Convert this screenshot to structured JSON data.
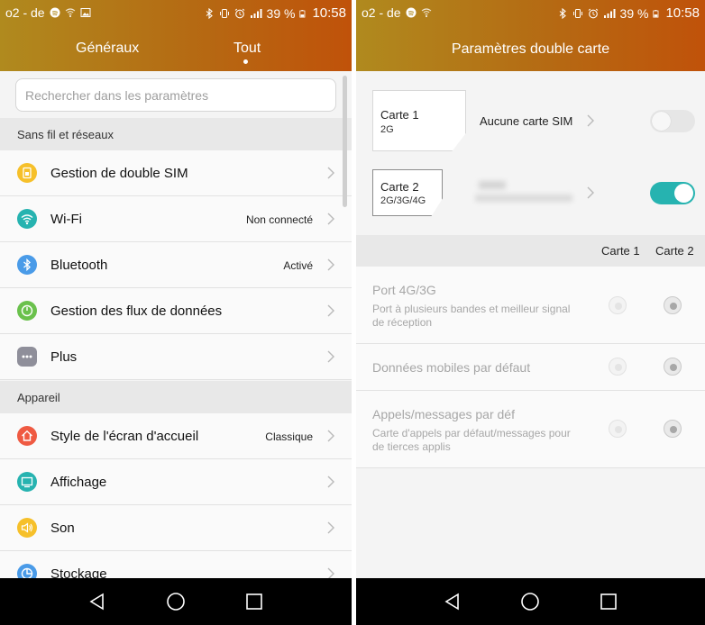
{
  "colors": {
    "header_gradient_start": "#b08a1e",
    "header_gradient_end": "#c0520a",
    "toggle_on": "#26b3b0",
    "toggle_off": "#e6e6e6",
    "section_bg": "#e8e8e8",
    "list_bg": "#fafafa"
  },
  "left": {
    "status": {
      "carrier": "o2 - de",
      "battery": "39 %",
      "time": "10:58"
    },
    "tabs": [
      {
        "label": "Généraux",
        "selected": false
      },
      {
        "label": "Tout",
        "selected": true
      }
    ],
    "search": {
      "placeholder": "Rechercher dans les paramètres"
    },
    "sections": [
      {
        "title": "Sans fil et réseaux",
        "items": [
          {
            "label": "Gestion de double SIM",
            "value": "",
            "icon": "dual-sim-icon",
            "icon_color": "#f6c02a"
          },
          {
            "label": "Wi-Fi",
            "value": "Non connecté",
            "icon": "wifi-icon",
            "icon_color": "#26b3b0"
          },
          {
            "label": "Bluetooth",
            "value": "Activé",
            "icon": "bluetooth-icon",
            "icon_color": "#4a9be8"
          },
          {
            "label": "Gestion des flux de données",
            "value": "",
            "icon": "data-usage-icon",
            "icon_color": "#6ac14c"
          },
          {
            "label": "Plus",
            "value": "",
            "icon": "more-icon",
            "icon_color": "#8f8f9a"
          }
        ]
      },
      {
        "title": "Appareil",
        "items": [
          {
            "label": "Style de l'écran d'accueil",
            "value": "Classique",
            "icon": "home-icon",
            "icon_color": "#ef5a42"
          },
          {
            "label": "Affichage",
            "value": "",
            "icon": "display-icon",
            "icon_color": "#26b3b0"
          },
          {
            "label": "Son",
            "value": "",
            "icon": "sound-icon",
            "icon_color": "#f6c02a"
          },
          {
            "label": "Stockage",
            "value": "",
            "icon": "storage-icon",
            "icon_color": "#4a9be8"
          }
        ]
      }
    ]
  },
  "right": {
    "status": {
      "carrier": "o2 - de",
      "battery": "39 %",
      "time": "10:58"
    },
    "title": "Paramètres double carte",
    "cards": [
      {
        "name": "Carte 1",
        "network": "2G",
        "status": "Aucune carte SIM",
        "enabled": false
      },
      {
        "name": "Carte 2",
        "network": "2G/3G/4G",
        "status": "",
        "enabled": true
      }
    ],
    "columns": [
      "Carte 1",
      "Carte 2"
    ],
    "options": [
      {
        "title": "Port 4G/3G",
        "subtitle": "Port à plusieurs bandes et meilleur signal de réception",
        "selected": "Carte 2"
      },
      {
        "title": "Données mobiles par défaut",
        "subtitle": "",
        "selected": "Carte 2"
      },
      {
        "title": "Appels/messages par déf",
        "subtitle": "Carte d'appels par défaut/messages pour de tierces applis",
        "selected": "Carte 2"
      }
    ]
  }
}
